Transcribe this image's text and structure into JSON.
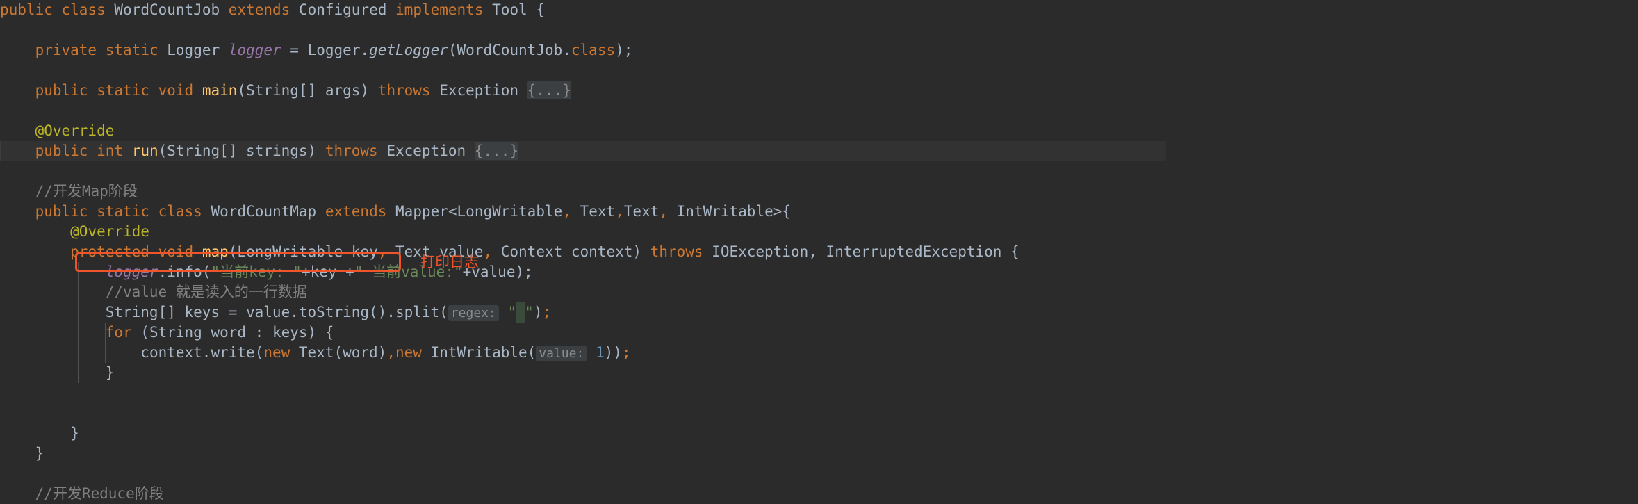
{
  "editor": {
    "theme": "darcula",
    "background_color": "#2b2b2b",
    "caret_line_color": "#323232",
    "margin_guide_x": 1680,
    "annotation_color": "#f1542a"
  },
  "annotations": {
    "print_log_note": "打印日志"
  },
  "code_lines": [
    {
      "id": "line-class-decl",
      "tokens": [
        {
          "t": "public",
          "c": "kw"
        },
        {
          "t": " ",
          "c": "txt"
        },
        {
          "t": "class",
          "c": "kw"
        },
        {
          "t": " ",
          "c": "txt"
        },
        {
          "t": "WordCountJob",
          "c": "txt"
        },
        {
          "t": " ",
          "c": "txt"
        },
        {
          "t": "extends",
          "c": "kw"
        },
        {
          "t": " ",
          "c": "txt"
        },
        {
          "t": "Configured",
          "c": "txt"
        },
        {
          "t": " ",
          "c": "txt"
        },
        {
          "t": "implements",
          "c": "kw"
        },
        {
          "t": " ",
          "c": "txt"
        },
        {
          "t": "Tool {",
          "c": "txt"
        }
      ]
    },
    {
      "id": "line-blank-1",
      "tokens": []
    },
    {
      "id": "line-logger-field",
      "tokens": [
        {
          "t": "    ",
          "c": "txt"
        },
        {
          "t": "private",
          "c": "kw"
        },
        {
          "t": " ",
          "c": "txt"
        },
        {
          "t": "static",
          "c": "kw"
        },
        {
          "t": " ",
          "c": "txt"
        },
        {
          "t": "Logger ",
          "c": "txt"
        },
        {
          "t": "logger",
          "c": "fld"
        },
        {
          "t": " = Logger.",
          "c": "txt"
        },
        {
          "t": "getLogger",
          "c": "mth"
        },
        {
          "t": "(WordCountJob.",
          "c": "txt"
        },
        {
          "t": "class",
          "c": "kw"
        },
        {
          "t": ");",
          "c": "txt"
        }
      ]
    },
    {
      "id": "line-blank-2",
      "tokens": []
    },
    {
      "id": "line-main-method",
      "tokens": [
        {
          "t": "    ",
          "c": "txt"
        },
        {
          "t": "public",
          "c": "kw"
        },
        {
          "t": " ",
          "c": "txt"
        },
        {
          "t": "static",
          "c": "kw"
        },
        {
          "t": " ",
          "c": "txt"
        },
        {
          "t": "void",
          "c": "kw"
        },
        {
          "t": " ",
          "c": "txt"
        },
        {
          "t": "main",
          "c": "fn"
        },
        {
          "t": "(String[] args) ",
          "c": "txt"
        },
        {
          "t": "throws",
          "c": "kw"
        },
        {
          "t": " Exception ",
          "c": "txt"
        },
        {
          "t": "{...}",
          "c": "fold"
        }
      ]
    },
    {
      "id": "line-blank-3",
      "tokens": []
    },
    {
      "id": "line-override-1",
      "tokens": [
        {
          "t": "    ",
          "c": "txt"
        },
        {
          "t": "@Override",
          "c": "ann"
        }
      ]
    },
    {
      "id": "line-run-method",
      "caret": true,
      "tokens": [
        {
          "t": "    ",
          "c": "txt"
        },
        {
          "t": "public",
          "c": "kw"
        },
        {
          "t": " ",
          "c": "txt"
        },
        {
          "t": "int",
          "c": "kw"
        },
        {
          "t": " ",
          "c": "txt"
        },
        {
          "t": "run",
          "c": "fn"
        },
        {
          "t": "(String[] strings) ",
          "c": "txt"
        },
        {
          "t": "throws",
          "c": "kw"
        },
        {
          "t": " Exception ",
          "c": "txt"
        },
        {
          "t": "{...}",
          "c": "fold"
        }
      ]
    },
    {
      "id": "line-blank-4",
      "tokens": []
    },
    {
      "id": "line-comment-map-stage",
      "tokens": [
        {
          "t": "    ",
          "c": "txt"
        },
        {
          "t": "//开发Map阶段",
          "c": "cmt"
        }
      ]
    },
    {
      "id": "line-wordcountmap-class",
      "tokens": [
        {
          "t": "    ",
          "c": "txt"
        },
        {
          "t": "public",
          "c": "kw"
        },
        {
          "t": " ",
          "c": "txt"
        },
        {
          "t": "static",
          "c": "kw"
        },
        {
          "t": " ",
          "c": "txt"
        },
        {
          "t": "class",
          "c": "kw"
        },
        {
          "t": " ",
          "c": "txt"
        },
        {
          "t": "WordCountMap",
          "c": "txt"
        },
        {
          "t": " ",
          "c": "txt"
        },
        {
          "t": "extends",
          "c": "kw"
        },
        {
          "t": " ",
          "c": "txt"
        },
        {
          "t": "Mapper<LongWritable",
          "c": "txt"
        },
        {
          "t": ",",
          "c": "kw"
        },
        {
          "t": " Text",
          "c": "txt"
        },
        {
          "t": ",",
          "c": "kw"
        },
        {
          "t": "Text",
          "c": "txt"
        },
        {
          "t": ",",
          "c": "kw"
        },
        {
          "t": " IntWritable>{",
          "c": "txt"
        }
      ]
    },
    {
      "id": "line-override-2",
      "tokens": [
        {
          "t": "        ",
          "c": "txt"
        },
        {
          "t": "@Override",
          "c": "ann"
        }
      ]
    },
    {
      "id": "line-map-method",
      "tokens": [
        {
          "t": "        ",
          "c": "txt"
        },
        {
          "t": "protected",
          "c": "kw"
        },
        {
          "t": " ",
          "c": "txt"
        },
        {
          "t": "void",
          "c": "kw"
        },
        {
          "t": " ",
          "c": "txt"
        },
        {
          "t": "map",
          "c": "fn"
        },
        {
          "t": "(LongWritable key",
          "c": "txt"
        },
        {
          "t": ",",
          "c": "kw"
        },
        {
          "t": " Text value",
          "c": "txt"
        },
        {
          "t": ",",
          "c": "kw"
        },
        {
          "t": " Context context) ",
          "c": "txt"
        },
        {
          "t": "throws",
          "c": "kw"
        },
        {
          "t": " IOException, InterruptedException {",
          "c": "txt"
        }
      ]
    },
    {
      "id": "line-logger-info",
      "boxed": true,
      "tokens": [
        {
          "t": "            ",
          "c": "txt"
        },
        {
          "t": "logger",
          "c": "fld"
        },
        {
          "t": ".info(",
          "c": "txt"
        },
        {
          "t": "\"当前key: \"",
          "c": "str"
        },
        {
          "t": "+key +",
          "c": "txt"
        },
        {
          "t": "\" 当前value:\"",
          "c": "str"
        },
        {
          "t": "+value);",
          "c": "txt"
        }
      ]
    },
    {
      "id": "line-comment-value",
      "tokens": [
        {
          "t": "            ",
          "c": "txt"
        },
        {
          "t": "//value 就是读入的一行数据",
          "c": "cmt"
        }
      ]
    },
    {
      "id": "line-split",
      "tokens": [
        {
          "t": "            ",
          "c": "txt"
        },
        {
          "t": "String[] keys = value.toString().split(",
          "c": "txt"
        },
        {
          "t": "regex:",
          "c": "hint"
        },
        {
          "t": " ",
          "c": "txt"
        },
        {
          "t": "\"",
          "c": "str"
        },
        {
          "t": " ",
          "c": "sp-high"
        },
        {
          "t": "\"",
          "c": "str"
        },
        {
          "t": ")",
          "c": "txt"
        },
        {
          "t": ";",
          "c": "kw"
        }
      ]
    },
    {
      "id": "line-for-loop",
      "tokens": [
        {
          "t": "            ",
          "c": "txt"
        },
        {
          "t": "for",
          "c": "kw"
        },
        {
          "t": " (String word : keys) {",
          "c": "txt"
        }
      ]
    },
    {
      "id": "line-context-write",
      "tokens": [
        {
          "t": "                ",
          "c": "txt"
        },
        {
          "t": "context.write(",
          "c": "txt"
        },
        {
          "t": "new",
          "c": "kw"
        },
        {
          "t": " Text(word)",
          "c": "txt"
        },
        {
          "t": ",",
          "c": "kw"
        },
        {
          "t": "new",
          "c": "kw"
        },
        {
          "t": " IntWritable(",
          "c": "txt"
        },
        {
          "t": "value:",
          "c": "hint"
        },
        {
          "t": " ",
          "c": "txt"
        },
        {
          "t": "1",
          "c": "num"
        },
        {
          "t": "))",
          "c": "txt"
        },
        {
          "t": ";",
          "c": "kw"
        }
      ]
    },
    {
      "id": "line-close-for",
      "tokens": [
        {
          "t": "            ",
          "c": "txt"
        },
        {
          "t": "}",
          "c": "txt"
        }
      ]
    },
    {
      "id": "line-blank-5",
      "tokens": []
    },
    {
      "id": "line-blank-6",
      "tokens": []
    },
    {
      "id": "line-close-map-method",
      "tokens": [
        {
          "t": "        ",
          "c": "txt"
        },
        {
          "t": "}",
          "c": "txt"
        }
      ]
    },
    {
      "id": "line-close-class",
      "tokens": [
        {
          "t": "    ",
          "c": "txt"
        },
        {
          "t": "}",
          "c": "txt"
        }
      ]
    },
    {
      "id": "line-blank-7",
      "tokens": []
    },
    {
      "id": "line-comment-reduce-stage",
      "tokens": [
        {
          "t": "    ",
          "c": "txt"
        },
        {
          "t": "//开发Reduce阶段",
          "c": "cmt"
        }
      ]
    }
  ]
}
